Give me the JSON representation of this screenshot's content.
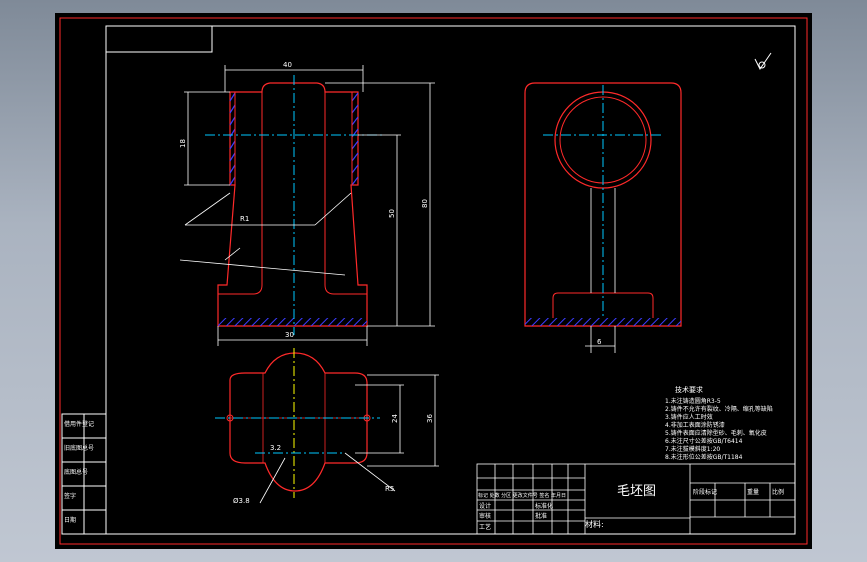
{
  "title_block": {
    "drawing_name": "毛坯图",
    "material_label": "材料:",
    "scale_header": "阶段标记",
    "weight_header": "重量",
    "ratio_header": "比例",
    "change_header": "标记 处数 分区 更改文件号 签名 年月日",
    "rows": [
      "设计",
      "审核",
      "工艺",
      "标准化",
      "批准"
    ]
  },
  "side_block": {
    "rows": [
      "借用件登记",
      "旧底图总号",
      "底图总号",
      "签字",
      "日期"
    ]
  },
  "notes": {
    "title": "技术要求",
    "items": [
      "1.未注铸造圆角R3-5",
      "2.铸件不允许有裂纹、冷隔、缩孔等缺陷",
      "3.铸件应人工时效",
      "4.非加工表面涂防锈漆",
      "5.铸件表面应清除型砂、毛刺、氧化皮",
      "6.未注尺寸公差按GB/T6414",
      "7.未注拔模斜度1:20",
      "8.未注形位公差按GB/T1184"
    ]
  },
  "dimensions": {
    "top_width": "40",
    "height_total": "80",
    "height_mid": "50",
    "bore_height": "18",
    "base_width": "30",
    "bottom_dim": "20",
    "side_dim": "6",
    "plan_width": "36",
    "plan_inner": "24",
    "callout_1": "R1",
    "callout_2": "R5",
    "callout_3": "Ø3.8",
    "callout_4": "3.2"
  },
  "colors": {
    "outline": "#ff2a2a",
    "center": "#00c8ff",
    "hatch": "#3b3bff",
    "dim": "#ffffff",
    "border": "#ff2a2a"
  }
}
